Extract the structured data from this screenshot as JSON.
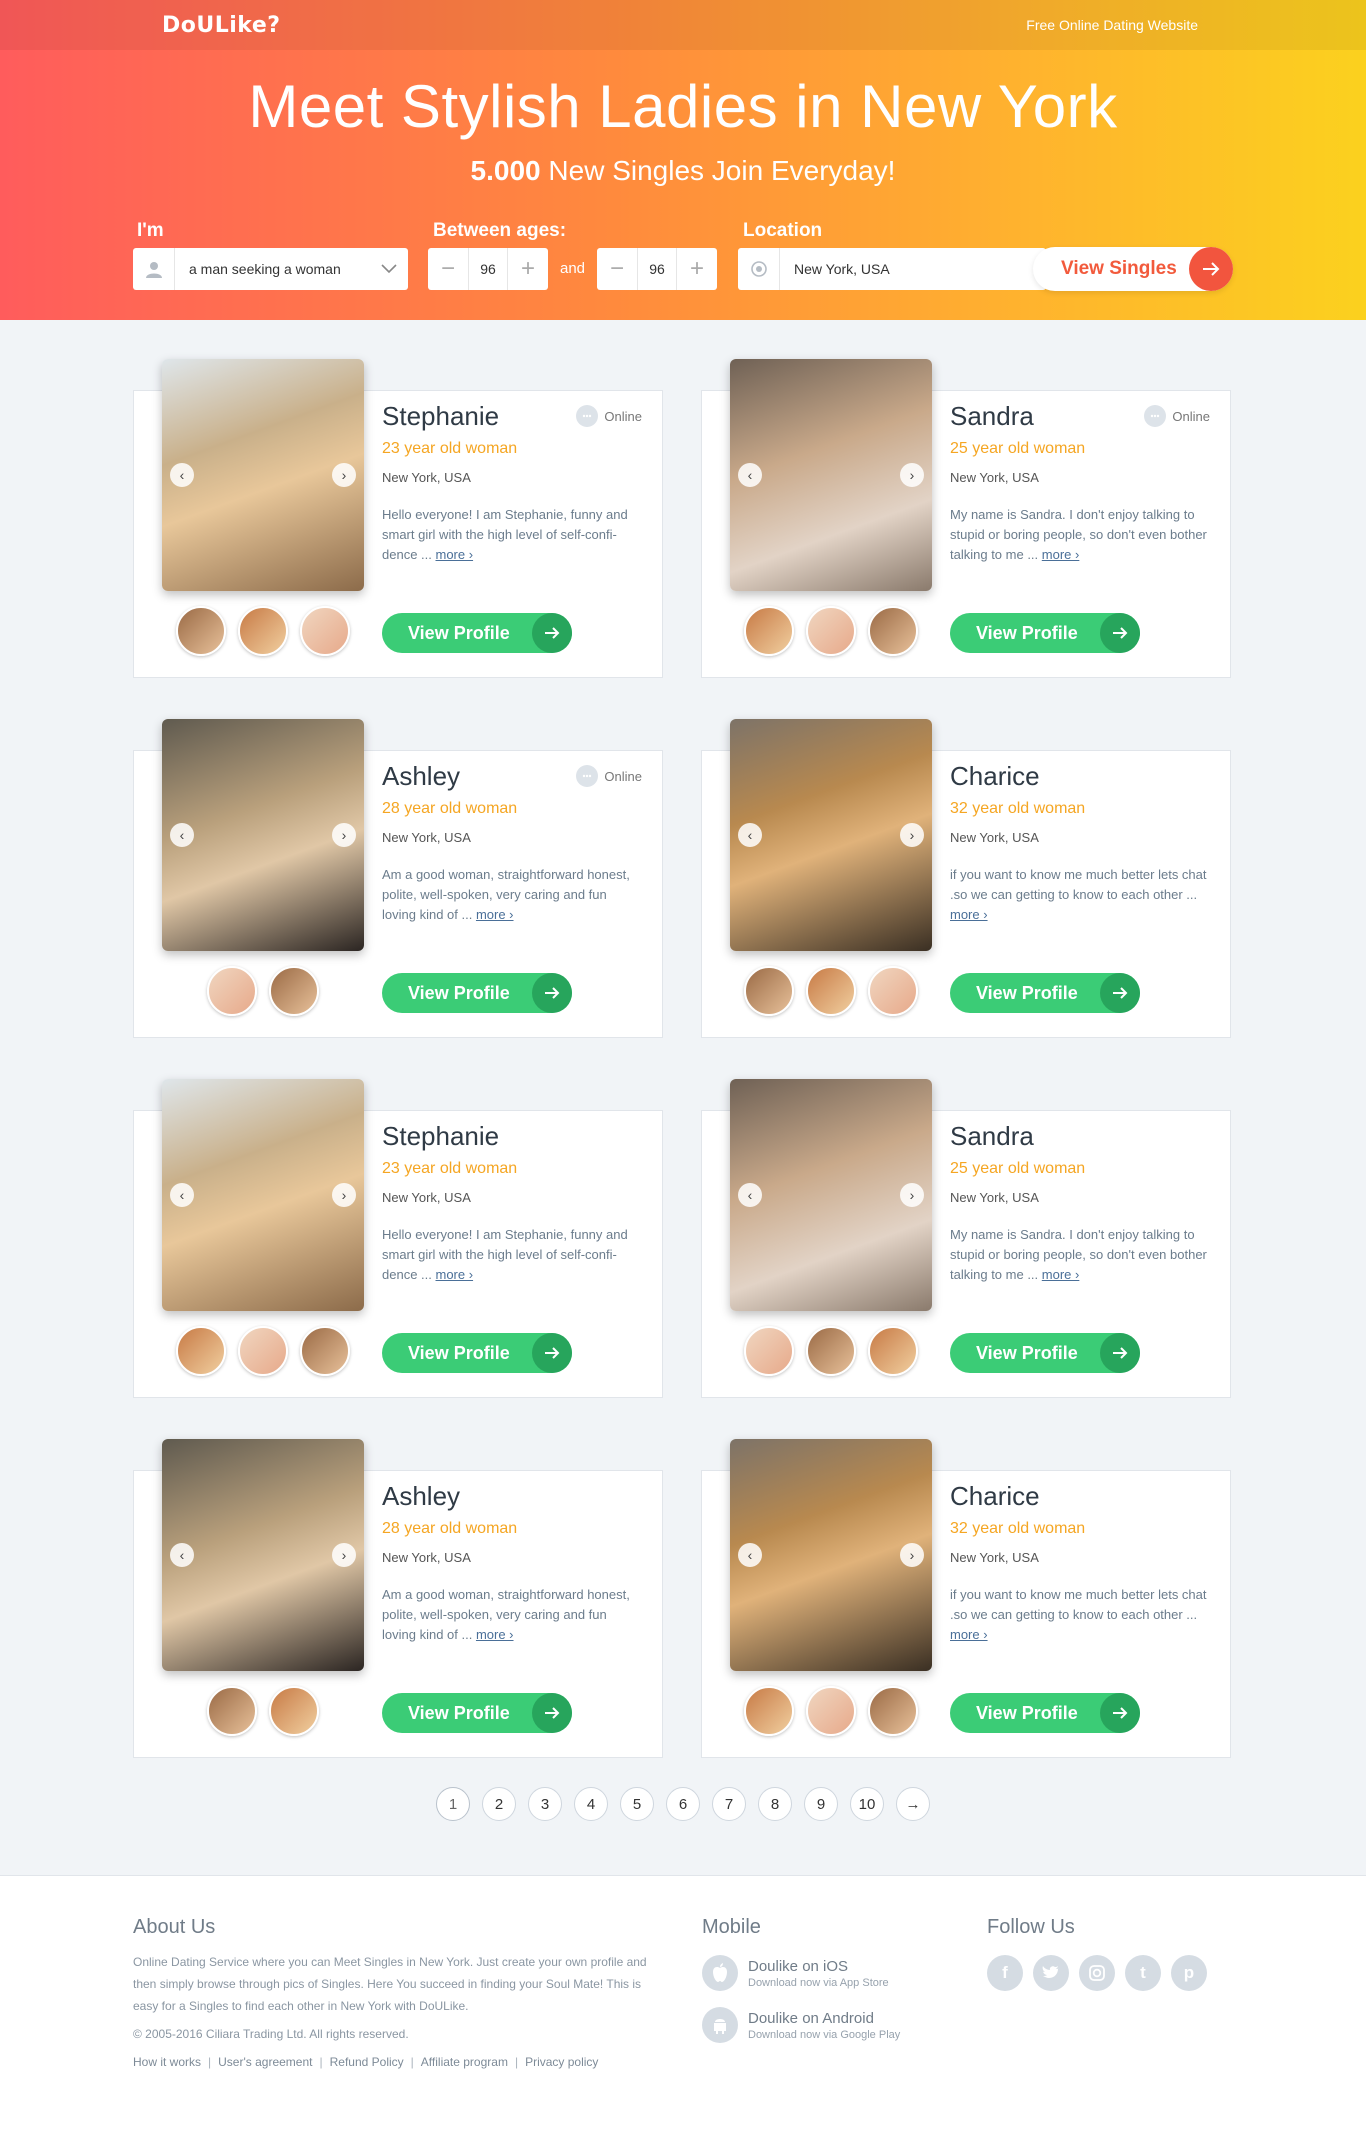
{
  "colors": {
    "accent": "#f2553e",
    "green": "#3bcc76",
    "age": "#f5a623"
  },
  "header": {
    "logo": "DoULike?",
    "tagline": "Free Online Dating Website",
    "title": "Meet Stylish Ladies in New York",
    "subtitle_count": "5.000",
    "subtitle_rest": " New Singles Join Everyday!"
  },
  "search": {
    "im_label": "I'm",
    "im_value": "a man seeking a woman",
    "ages_label": "Between ages:",
    "age_min": "96",
    "and_label": "and",
    "age_max": "96",
    "location_label": "Location",
    "location_value": "New York, USA",
    "button_label": "View Singles"
  },
  "profiles": [
    {
      "name": "Stephanie",
      "age": "23 year old woman",
      "location": "New York, USA",
      "online": "Online",
      "bio": "Hello everyone! I am Stephanie, funny and smart girl with the high level of self-confi-dence ...",
      "more": "more ›",
      "button": "View Profile"
    },
    {
      "name": "Sandra",
      "age": "25 year old woman",
      "location": "New York, USA",
      "online": "Online",
      "bio": "My name is Sandra. I don't enjoy talking to stupid or boring people, so don't even bother talking to me ...",
      "more": "more ›",
      "button": "View Profile"
    },
    {
      "name": "Ashley",
      "age": "28 year old woman",
      "location": "New York, USA",
      "online": "Online",
      "bio": "Am a good woman, straightforward honest, polite, well-spoken, very caring and fun loving kind of ...",
      "more": "more ›",
      "button": "View Profile"
    },
    {
      "name": "Charice",
      "age": "32 year old woman",
      "location": "New York, USA",
      "online": "",
      "bio": "if you want to know me much better lets chat .so we can getting to know to each other ...",
      "more": "more ›",
      "button": "View Profile"
    },
    {
      "name": "Stephanie",
      "age": "23 year old woman",
      "location": "New York, USA",
      "online": "",
      "bio": "Hello everyone! I am Stephanie, funny and smart girl with the high level of self-confi-dence ...",
      "more": "more ›",
      "button": "View Profile"
    },
    {
      "name": "Sandra",
      "age": "25 year old woman",
      "location": "New York, USA",
      "online": "",
      "bio": "My name is Sandra. I don't enjoy talking to stupid or boring people, so don't even bother talking to me ...",
      "more": "more ›",
      "button": "View Profile"
    },
    {
      "name": "Ashley",
      "age": "28 year old woman",
      "location": "New York, USA",
      "online": "",
      "bio": "Am a good woman, straightforward honest, polite, well-spoken, very caring and fun loving kind of ...",
      "more": "more ›",
      "button": "View Profile"
    },
    {
      "name": "Charice",
      "age": "32 year old woman",
      "location": "New York, USA",
      "online": "",
      "bio": "if you want to know me much better lets chat .so we can getting to know to each other ...",
      "more": "more ›",
      "button": "View Profile"
    }
  ],
  "pagination": [
    "1",
    "2",
    "3",
    "4",
    "5",
    "6",
    "7",
    "8",
    "9",
    "10",
    "→"
  ],
  "footer": {
    "about_title": "About Us",
    "about_text": "Online Dating Service where you can Meet Singles in New York. Just create your own profile and then simply browse through pics of Singles. Here You succeed in finding your Soul Mate! This is easy for a Singles to find each other in New York with DoULike.",
    "copyright": "© 2005-2016 Ciliara Trading Ltd. All rights reserved.",
    "links": [
      "How it works",
      "User's agreement",
      "Refund Policy",
      "Affiliate program",
      "Privacy policy"
    ],
    "mobile_title": "Mobile",
    "ios_title": "Doulike on iOS",
    "ios_sub": "Download now via App Store",
    "android_title": "Doulike on Android",
    "android_sub": "Download now via Google Play",
    "follow_title": "Follow Us"
  }
}
